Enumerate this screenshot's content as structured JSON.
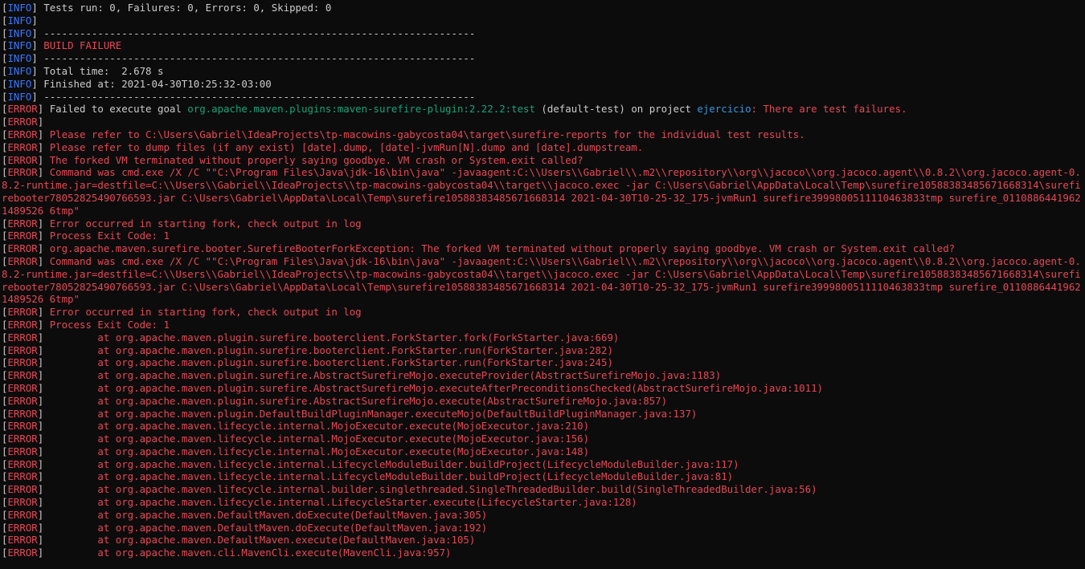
{
  "terminal": {
    "colors": {
      "background": "#0c0c0c",
      "default": "#cccccc",
      "info_level": "#3b78ff",
      "error": "#e74856",
      "plugin": "#16a37a",
      "project": "#3a96dd"
    },
    "lines": [
      {
        "level": "INFO",
        "text": "Tests run: 0, Failures: 0, Errors: 0, Skipped: 0"
      },
      {
        "level": "INFO",
        "text": ""
      },
      {
        "level": "INFO",
        "text": "------------------------------------------------------------------------"
      },
      {
        "level": "INFO",
        "text": "BUILD FAILURE",
        "color": "red"
      },
      {
        "level": "INFO",
        "text": "------------------------------------------------------------------------"
      },
      {
        "level": "INFO",
        "text": "Total time:  2.678 s"
      },
      {
        "level": "INFO",
        "text": "Finished at: 2021-04-30T10:25:32-03:00"
      },
      {
        "level": "INFO",
        "text": "------------------------------------------------------------------------"
      },
      {
        "level": "ERROR",
        "segments": [
          {
            "text": "Failed to execute goal ",
            "color": "default"
          },
          {
            "text": "org.apache.maven.plugins:maven-surefire-plugin:2.22.2:test",
            "color": "green"
          },
          {
            "text": " (default-test)",
            "color": "default"
          },
          {
            "text": " on project ",
            "color": "default"
          },
          {
            "text": "ejercicio",
            "color": "cyan"
          },
          {
            "text": ": There are test failures.",
            "color": "red"
          }
        ]
      },
      {
        "level": "ERROR",
        "text": ""
      },
      {
        "level": "ERROR",
        "text": "Please refer to C:\\Users\\Gabriel\\IdeaProjects\\tp-macowins-gabycosta04\\target\\surefire-reports for the individual test results."
      },
      {
        "level": "ERROR",
        "text": "Please refer to dump files (if any exist) [date].dump, [date]-jvmRun[N].dump and [date].dumpstream."
      },
      {
        "level": "ERROR",
        "text": "The forked VM terminated without properly saying goodbye. VM crash or System.exit called?"
      },
      {
        "level": "ERROR",
        "text": "Command was cmd.exe /X /C \"\"C:\\Program Files\\Java\\jdk-16\\bin\\java\" -javaagent:C:\\\\Users\\\\Gabriel\\\\.m2\\\\repository\\\\org\\\\jacoco\\\\org.jacoco.agent\\\\0.8.2\\\\org.jacoco.agent-0.8.2-runtime.jar=destfile=C:\\\\Users\\\\Gabriel\\\\IdeaProjects\\\\tp-macowins-gabycosta04\\\\target\\\\jacoco.exec -jar C:\\Users\\Gabriel\\AppData\\Local\\Temp\\surefire10588383485671668314\\surefirebooter7805282549076659З.jar C:\\Users\\Gabriel\\AppData\\Local\\Temp\\surefire10588383485671668314 2021-04-30T10-25-32_175-jvmRun1 surefire3999800511110463833tmp surefire_01108864419621489526 6tmp\""
      },
      {
        "level": "ERROR",
        "text": "Error occurred in starting fork, check output in log"
      },
      {
        "level": "ERROR",
        "text": "Process Exit Code: 1"
      },
      {
        "level": "ERROR",
        "text": "org.apache.maven.surefire.booter.SurefireBooterForkException: The forked VM terminated without properly saying goodbye. VM crash or System.exit called?"
      },
      {
        "level": "ERROR",
        "text": "Command was cmd.exe /X /C \"\"C:\\Program Files\\Java\\jdk-16\\bin\\java\" -javaagent:C:\\\\Users\\\\Gabriel\\\\.m2\\\\repository\\\\org\\\\jacoco\\\\org.jacoco.agent\\\\0.8.2\\\\org.jacoco.agent-0.8.2-runtime.jar=destfile=C:\\\\Users\\\\Gabriel\\\\IdeaProjects\\\\tp-macowins-gabycosta04\\\\target\\\\jacoco.exec -jar C:\\Users\\Gabriel\\AppData\\Local\\Temp\\surefire10588383485671668314\\surefirebooter7805282549076659З.jar C:\\Users\\Gabriel\\AppData\\Local\\Temp\\surefire10588383485671668314 2021-04-30T10-25-32_175-jvmRun1 surefire3999800511110463833tmp surefire_01108864419621489526 6tmp\""
      },
      {
        "level": "ERROR",
        "text": "Error occurred in starting fork, check output in log"
      },
      {
        "level": "ERROR",
        "text": "Process Exit Code: 1"
      },
      {
        "level": "ERROR",
        "text": "        at org.apache.maven.plugin.surefire.booterclient.ForkStarter.fork(ForkStarter.java:669)"
      },
      {
        "level": "ERROR",
        "text": "        at org.apache.maven.plugin.surefire.booterclient.ForkStarter.run(ForkStarter.java:282)"
      },
      {
        "level": "ERROR",
        "text": "        at org.apache.maven.plugin.surefire.booterclient.ForkStarter.run(ForkStarter.java:245)"
      },
      {
        "level": "ERROR",
        "text": "        at org.apache.maven.plugin.surefire.AbstractSurefireMojo.executeProvider(AbstractSurefireMojo.java:1183)"
      },
      {
        "level": "ERROR",
        "text": "        at org.apache.maven.plugin.surefire.AbstractSurefireMojo.executeAfterPreconditionsChecked(AbstractSurefireMojo.java:1011)"
      },
      {
        "level": "ERROR",
        "text": "        at org.apache.maven.plugin.surefire.AbstractSurefireMojo.execute(AbstractSurefireMojo.java:857)"
      },
      {
        "level": "ERROR",
        "text": "        at org.apache.maven.plugin.DefaultBuildPluginManager.executeMojo(DefaultBuildPluginManager.java:137)"
      },
      {
        "level": "ERROR",
        "text": "        at org.apache.maven.lifecycle.internal.MojoExecutor.execute(MojoExecutor.java:210)"
      },
      {
        "level": "ERROR",
        "text": "        at org.apache.maven.lifecycle.internal.MojoExecutor.execute(MojoExecutor.java:156)"
      },
      {
        "level": "ERROR",
        "text": "        at org.apache.maven.lifecycle.internal.MojoExecutor.execute(MojoExecutor.java:148)"
      },
      {
        "level": "ERROR",
        "text": "        at org.apache.maven.lifecycle.internal.LifecycleModuleBuilder.buildProject(LifecycleModuleBuilder.java:117)"
      },
      {
        "level": "ERROR",
        "text": "        at org.apache.maven.lifecycle.internal.LifecycleModuleBuilder.buildProject(LifecycleModuleBuilder.java:81)"
      },
      {
        "level": "ERROR",
        "text": "        at org.apache.maven.lifecycle.internal.builder.singlethreaded.SingleThreadedBuilder.build(SingleThreadedBuilder.java:56)"
      },
      {
        "level": "ERROR",
        "text": "        at org.apache.maven.lifecycle.internal.LifecycleStarter.execute(LifecycleStarter.java:128)"
      },
      {
        "level": "ERROR",
        "text": "        at org.apache.maven.DefaultMaven.doExecute(DefaultMaven.java:305)"
      },
      {
        "level": "ERROR",
        "text": "        at org.apache.maven.DefaultMaven.doExecute(DefaultMaven.java:192)"
      },
      {
        "level": "ERROR",
        "text": "        at org.apache.maven.DefaultMaven.execute(DefaultMaven.java:105)"
      },
      {
        "level": "ERROR",
        "text": "        at org.apache.maven.cli.MavenCli.execute(MavenCli.java:957)"
      }
    ]
  }
}
